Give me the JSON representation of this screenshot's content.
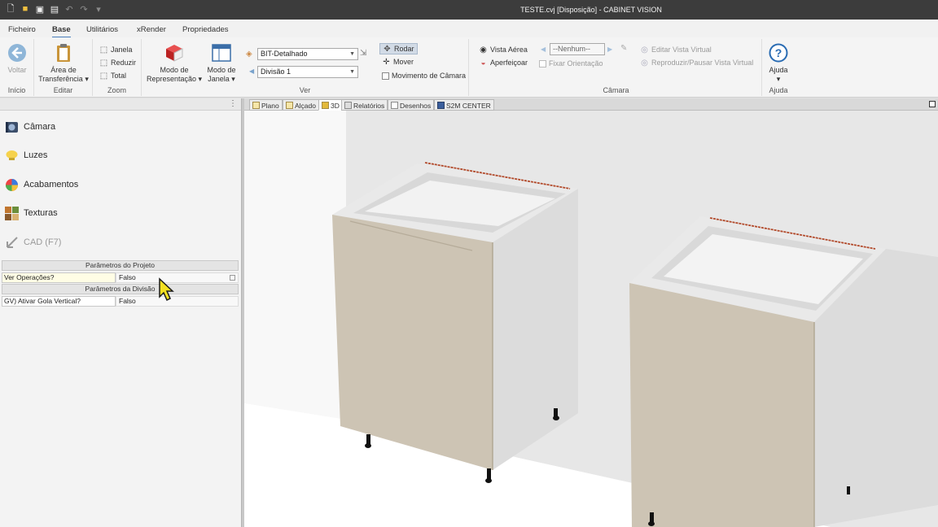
{
  "window": {
    "title": "TESTE.cvj [Disposição] - CABINET VISION"
  },
  "quick_access": [
    "new-file-icon",
    "open-folder-icon",
    "save-icon",
    "print-icon",
    "undo-icon",
    "redo-icon",
    "customize-icon"
  ],
  "menu_tabs": [
    {
      "label": "Ficheiro"
    },
    {
      "label": "Base",
      "active": true
    },
    {
      "label": "Utilitários"
    },
    {
      "label": "xRender"
    },
    {
      "label": "Propriedades"
    }
  ],
  "ribbon": {
    "inicio": {
      "group": "Início",
      "voltar": "Voltar"
    },
    "editar": {
      "group": "Editar",
      "area_line1": "Área de",
      "area_line2": "Transferência"
    },
    "zoom": {
      "group": "Zoom",
      "janela": "Janela",
      "reduzir": "Reduzir",
      "total": "Total"
    },
    "ver": {
      "group": "Ver",
      "modo_rep_line1": "Modo de",
      "modo_rep_line2": "Representação",
      "modo_janela_line1": "Modo de",
      "modo_janela_line2": "Janela",
      "combo_detalhe": "BIT-Detalhado",
      "combo_divisao": "Divisão 1",
      "rodar": "Rodar",
      "mover": "Mover",
      "movimento_camara": "Movimento de Câmara"
    },
    "camara": {
      "group": "Câmara",
      "vista_aerea": "Vista Aérea",
      "aperfeicoar": "Aperfeiçoar",
      "nenhum": "--Nenhum--",
      "fixar_orientacao": "Fixar Orientação",
      "editar_vista_virtual": "Editar Vista Virtual",
      "reproduzir_pausar": "Reproduzir/Pausar Vista Virtual"
    },
    "ajuda": {
      "group": "Ajuda",
      "ajuda": "Ajuda"
    }
  },
  "left_panel": {
    "nav": [
      {
        "label": "Câmara",
        "icon": "camera-icon"
      },
      {
        "label": "Luzes",
        "icon": "lightbulb-icon"
      },
      {
        "label": "Acabamentos",
        "icon": "color-wheel-icon"
      },
      {
        "label": "Texturas",
        "icon": "textures-icon"
      },
      {
        "label": "CAD (F7)",
        "icon": "cad-arrow-icon",
        "disabled": true
      }
    ],
    "sections": {
      "projeto": "Parâmetros do Projeto",
      "divisao": "Parâmetros da Divisão"
    },
    "params": {
      "ver_operacoes": {
        "name": "Ver Operações?",
        "value": "Falso"
      },
      "gola_vertical": {
        "name": "GV) Ativar Gola Vertical?",
        "value": "Falso"
      }
    }
  },
  "view_tabs": [
    {
      "label": "Plano"
    },
    {
      "label": "Alçado"
    },
    {
      "label": "3D",
      "active": true
    },
    {
      "label": "Relatórios"
    },
    {
      "label": "Desenhos"
    },
    {
      "label": "S2M CENTER"
    }
  ],
  "colors": {
    "titlebar": "#3c3c3c",
    "door": "#cdc4b4",
    "cabinet_side": "#dadada",
    "wall": "#e6e6e6",
    "accent": "#4a7ebb"
  }
}
